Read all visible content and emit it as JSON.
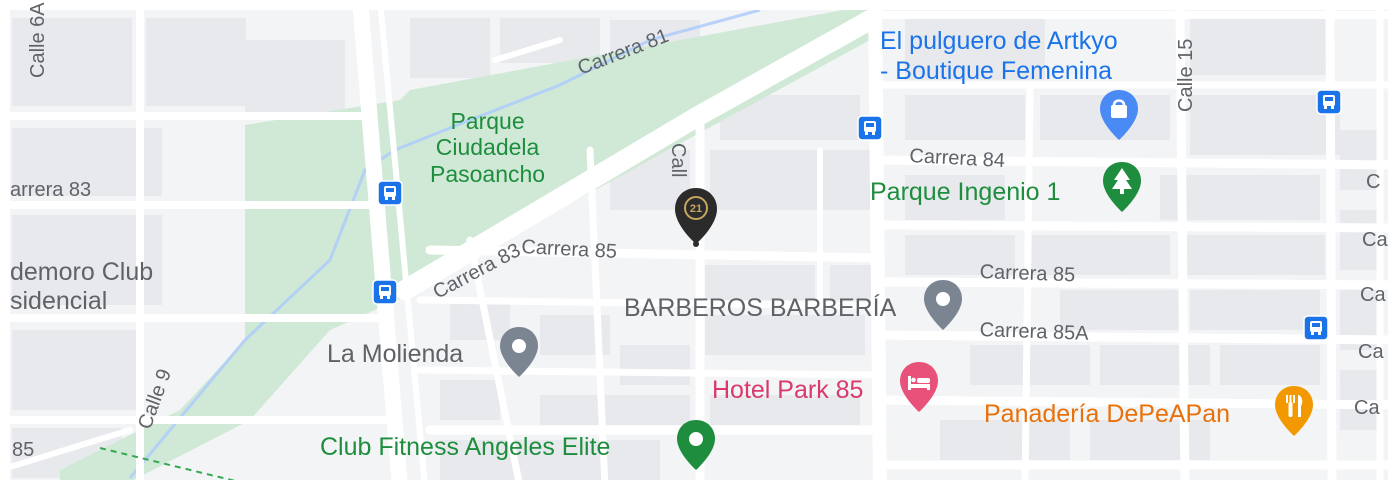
{
  "colors": {
    "land": "#f3f4f6",
    "block": "#e7e9ec",
    "road": "#ffffff",
    "park": "#cfe9d6",
    "river": "#aecbfa",
    "transit_blue": "#1a73e8",
    "hotel_pink": "#d93a6b",
    "restaurant_orange": "#e8710a",
    "park_green": "#1e8e3e",
    "poi_grey": "#5f6368"
  },
  "streets": {
    "calle_6a": "Calle 6A",
    "carrera_81": "Carrera 81",
    "calle_15": "Calle 15",
    "carrera_83_left": "arrera 83",
    "carrera_83": "Carrera 83",
    "calle_mid": "Call",
    "carrera_84": "Carrera 84",
    "carrera_85_mid": "Carrera 85",
    "carrera_85_right": "Carrera 85",
    "carrera_85a": "Carrera 85A",
    "calle_9": "Calle 9",
    "carrera_85_left": "85",
    "edge_c": "C",
    "edge_ca_1": "Ca",
    "edge_ca_2": "Ca",
    "edge_ca_3": "Ca",
    "edge_ca_4": "Ca"
  },
  "places": {
    "parque_ciudadela": "Parque\nCiudadela\nPasoancho",
    "residential": "demoro Club\nsidencial",
    "el_pulguero": "El pulguero de Artkyo\n- Boutique Femenina",
    "parque_ingenio": "Parque Ingenio 1",
    "barberos": "BARBEROS BARBERÍA",
    "la_molienda": "La Molienda",
    "hotel_park": "Hotel Park 85",
    "panaderia": "Panadería DePeAPan",
    "club_fitness": "Club Fitness Angeles Elite"
  },
  "marker": {
    "label": "21",
    "icon": "century21-pin-icon"
  },
  "icons": {
    "bus": "bus-stop-icon",
    "shopping": "shopping-bag-icon",
    "tree": "tree-icon",
    "place": "place-pin-icon",
    "bed": "bed-icon",
    "fork": "fork-knife-icon",
    "dumbbell": "dumbbell-icon"
  }
}
